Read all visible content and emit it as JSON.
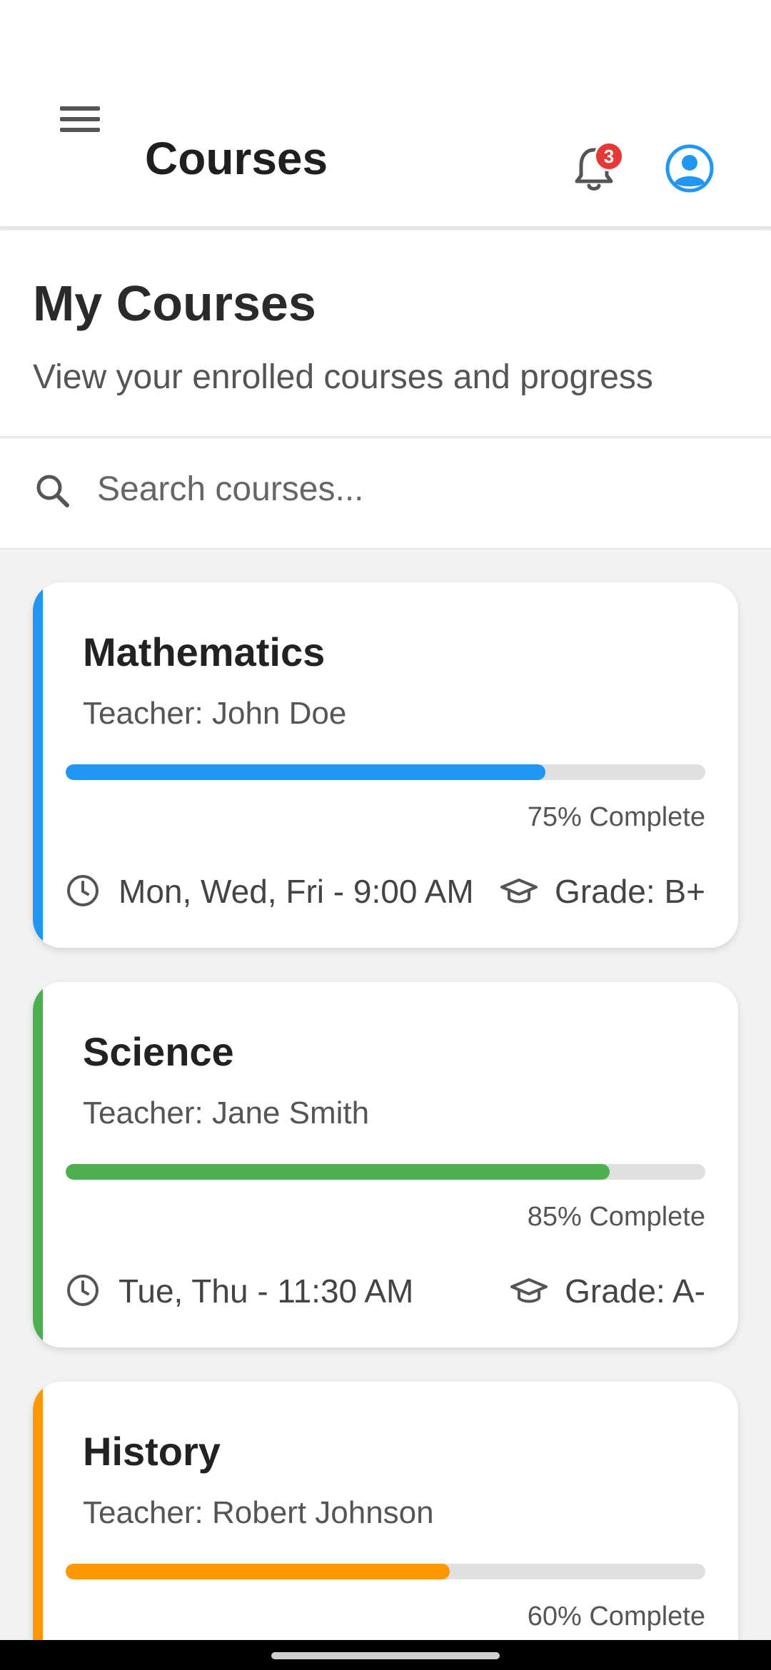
{
  "app_bar": {
    "title": "Courses",
    "notification_count": "3"
  },
  "header": {
    "title": "My Courses",
    "subtitle": "View your enrolled courses and progress"
  },
  "search": {
    "placeholder": "Search courses..."
  },
  "colors": {
    "math_accent": "#2196F3",
    "science_accent": "#4CAF50",
    "history_accent": "#FF9800",
    "badge": "#E53935",
    "profile_icon": "#2196F3"
  },
  "courses": [
    {
      "name": "Mathematics",
      "teacher": "Teacher: John Doe",
      "progress": 75,
      "progress_label": "75% Complete",
      "schedule": "Mon, Wed, Fri - 9:00 AM",
      "grade": "Grade: B+"
    },
    {
      "name": "Science",
      "teacher": "Teacher: Jane Smith",
      "progress": 85,
      "progress_label": "85% Complete",
      "schedule": "Tue, Thu - 11:30 AM",
      "grade": "Grade: A-"
    },
    {
      "name": "History",
      "teacher": "Teacher: Robert Johnson",
      "progress": 60,
      "progress_label": "60% Complete",
      "schedule": "",
      "grade": ""
    }
  ]
}
